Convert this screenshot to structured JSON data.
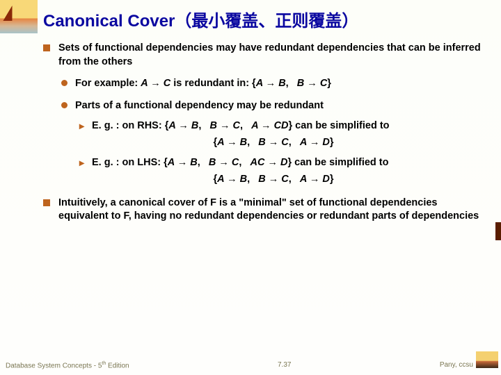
{
  "title": "Canonical Cover（最小覆盖、正则覆盖）",
  "b1": "Sets of functional dependencies may have redundant dependencies that can be inferred from the others",
  "b1a_pre": "For example:  ",
  "b1a_expr": "A → C",
  "b1a_mid": " is redundant in:   {",
  "b1a_s1": "A → B",
  "b1a_s2": "B → C",
  "b1b": "Parts of a functional dependency may be redundant",
  "eg_label": "E. g. : ",
  "rhs_t": "on RHS:   {",
  "rhs_a": "A → B",
  "rhs_b": "B → C",
  "rhs_c": "A → CD",
  "canbe": "}  can be simplified to",
  "rhs_res_a": "A → B",
  "rhs_res_b": "B → C",
  "rhs_res_c": "A → D",
  "lhs_t": "on LHS:    {",
  "lhs_a": "A → B",
  "lhs_b": "B → C",
  "lhs_c": "AC → D",
  "lhs_res_a": "A → B",
  "lhs_res_b": "B → C",
  "lhs_res_c": "A → D",
  "b2": "Intuitively, a canonical cover of F is a \"minimal\" set of functional dependencies equivalent to F, having no redundant dependencies or redundant parts of dependencies",
  "footer_left_a": "Database System Concepts - 5",
  "footer_left_b": "th",
  "footer_left_c": " Edition",
  "footer_center": "7.37",
  "footer_right": "Pany, ccsu"
}
